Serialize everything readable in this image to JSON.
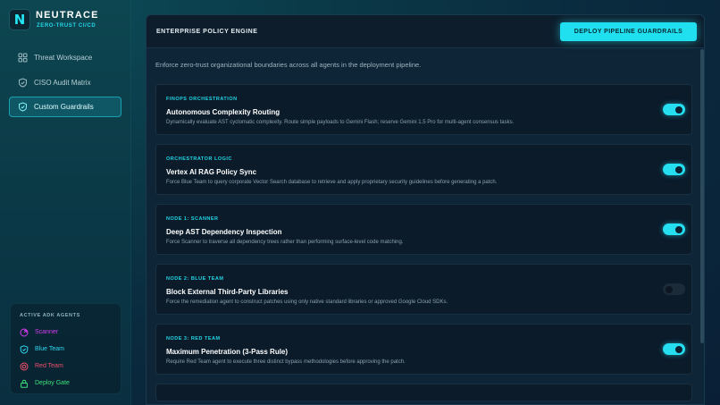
{
  "brand": {
    "logo_letter": "N",
    "name": "NEUTRACE",
    "subtitle": "ZERO-TRUST CI/CD"
  },
  "nav": {
    "items": [
      {
        "label": "Threat Workspace",
        "icon": "grid-icon",
        "active": false
      },
      {
        "label": "CISO Audit Matrix",
        "icon": "shield-icon",
        "active": false
      },
      {
        "label": "Custom Guardrails",
        "icon": "shield-icon",
        "active": true
      }
    ]
  },
  "agents": {
    "title": "ACTIVE ADK AGENTS",
    "items": [
      {
        "label": "Scanner",
        "icon": "radar-icon",
        "color": "#d63cf0"
      },
      {
        "label": "Blue Team",
        "icon": "shield-icon",
        "color": "#2ed8ef"
      },
      {
        "label": "Red Team",
        "icon": "target-icon",
        "color": "#f0506a"
      },
      {
        "label": "Deploy Gate",
        "icon": "lock-icon",
        "color": "#3ee07a"
      }
    ]
  },
  "panel": {
    "title": "ENTERPRISE POLICY ENGINE",
    "deploy_label": "DEPLOY PIPELINE GUARDRAILS",
    "intro": "Enforce zero-trust organizational boundaries across all agents in the deployment pipeline."
  },
  "policies": [
    {
      "tag": "FINOPS ORCHESTRATION",
      "title": "Autonomous Complexity Routing",
      "desc": "Dynamically evaluate AST cyclomatic complexity. Route simple payloads to Gemini Flash; reserve Gemini 1.5 Pro for multi-agent consensus tasks.",
      "enabled": true
    },
    {
      "tag": "ORCHESTRATOR LOGIC",
      "title": "Vertex AI RAG Policy Sync",
      "desc": "Force Blue Team to query corporate Vector Search database to retrieve and apply proprietary security guidelines before generating a patch.",
      "enabled": true
    },
    {
      "tag": "NODE 1: SCANNER",
      "title": "Deep AST Dependency Inspection",
      "desc": "Force Scanner to traverse all dependency trees rather than performing surface-level code matching.",
      "enabled": true
    },
    {
      "tag": "NODE 2: BLUE TEAM",
      "title": "Block External Third-Party Libraries",
      "desc": "Force the remediation agent to construct patches using only native standard libraries or approved Google Cloud SDKs.",
      "enabled": false
    },
    {
      "tag": "NODE 3: RED TEAM",
      "title": "Maximum Penetration (3-Pass Rule)",
      "desc": "Require Red Team agent to execute three distinct bypass methodologies before approving the patch.",
      "enabled": true
    }
  ],
  "colors": {
    "accent": "#20e0f0",
    "background": "#0a2233"
  }
}
